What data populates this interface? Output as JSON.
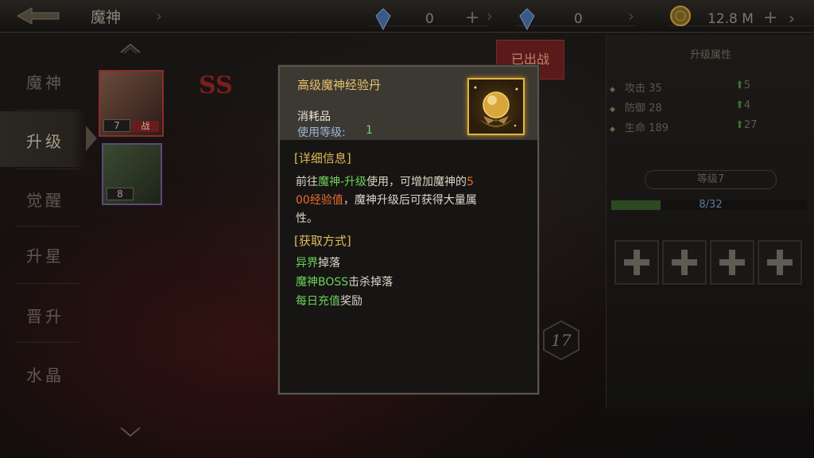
{
  "header": {
    "title": "魔神",
    "currency": [
      {
        "icon": "crystal-icon",
        "value": "0"
      },
      {
        "icon": "crystal-icon",
        "value": "0"
      },
      {
        "icon": "gold-coin-icon",
        "value": "12.8 M"
      }
    ]
  },
  "sidebar": {
    "items": [
      {
        "label": "魔神"
      },
      {
        "label": "升级"
      },
      {
        "label": "觉醒"
      },
      {
        "label": "升星"
      },
      {
        "label": "晋升"
      },
      {
        "label": "水晶"
      }
    ],
    "active_index": 1
  },
  "heroes": [
    {
      "level": "7",
      "tag": "战"
    },
    {
      "level": "8"
    }
  ],
  "background": {
    "rank": "SS",
    "deployed_label": "已出战",
    "level_badge": "17"
  },
  "upgrade_panel": {
    "title": "升级属性",
    "stats": [
      {
        "name": "攻击",
        "value": "35",
        "gain": "5"
      },
      {
        "name": "防御",
        "value": "28",
        "gain": "4"
      },
      {
        "name": "生命",
        "value": "189",
        "gain": "27"
      }
    ],
    "level_label": "等级7",
    "exp_text": "8/32",
    "exp_fraction": 0.25
  },
  "tooltip": {
    "name": "高级魔神经验丹",
    "type": "消耗品",
    "use_level_label": "使用等级:",
    "use_level_value": "1",
    "details_header": "[详细信息]",
    "desc": {
      "p1": "前往",
      "link": "魔神-升级",
      "p2": "使用，可增加魔神的",
      "exp_a": "5",
      "exp_b": "00经验值",
      "p3": "，魔神升级后可获得大量属",
      "p4": "性。"
    },
    "sources_header": "[获取方式]",
    "sources": [
      {
        "highlight": "异界",
        "rest": "掉落"
      },
      {
        "highlight": "魔神BOSS",
        "rest": "击杀掉落"
      },
      {
        "highlight": "每日充值",
        "rest": "奖励"
      }
    ]
  }
}
